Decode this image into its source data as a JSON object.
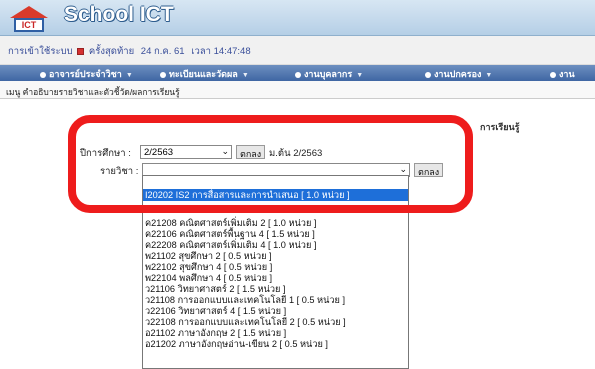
{
  "app": {
    "title": "School ICT",
    "logo_text": "ICT"
  },
  "last_login": {
    "text": "การเข้าใช้ระบบ",
    "suffix": "ครั้งสุดท้าย",
    "date": "24 ก.ค. 61",
    "time_label": "เวลา",
    "time": "14:47:48"
  },
  "menu": [
    {
      "label": "อาจารย์ประจำวิชา"
    },
    {
      "label": "ทะเบียนและวัดผล"
    },
    {
      "label": "งานบุคลากร"
    },
    {
      "label": "งานปกครอง"
    },
    {
      "label": "งาน"
    }
  ],
  "breadcrumb": "เมนู คำอธิบายรายวิชาและตัวชี้วัด/ผลการเรียนรู้",
  "section_title": "การเรียนรู้",
  "form": {
    "year_label": "ปีการศึกษา :",
    "year_value": "2/2563",
    "ok_label": "ตกลง",
    "level_note": "ม.ต้น 2/2563",
    "subject_label": "รายวิชา :",
    "subject_value": "",
    "ok2_label": "ตกลง"
  },
  "colors": {
    "highlight": "#ee1c1c",
    "menu": "#4a6fab",
    "selected": "#1e6fd9"
  },
  "options": [
    {
      "text": "I20202 IS2 การสื่อสารและการนำเสนอ  [ 1.0 หน่วย ]",
      "selected": true
    },
    {
      "text": "ค21208 คณิตศาสตร์เพิ่มเติม 2  [ 1.0 หน่วย ]"
    },
    {
      "text": "ค22106 คณิตศาสตร์พื้นฐาน 4  [ 1.5 หน่วย ]"
    },
    {
      "text": "ค22208 คณิตศาสตร์เพิ่มเติม 4  [ 1.0 หน่วย ]"
    },
    {
      "text": "พ21102 สุขศึกษา 2  [ 0.5 หน่วย ]"
    },
    {
      "text": "พ22102 สุขศึกษา 4  [ 0.5 หน่วย ]"
    },
    {
      "text": "พ22104 พลศึกษา 4  [ 0.5 หน่วย ]"
    },
    {
      "text": "ว21106 วิทยาศาสตร์ 2  [ 1.5 หน่วย ]"
    },
    {
      "text": "ว21108 การออกแบบและเทคโนโลยี 1  [ 0.5 หน่วย ]"
    },
    {
      "text": "ว22106 วิทยาศาสตร์ 4  [ 1.5 หน่วย ]"
    },
    {
      "text": "ว22108 การออกแบบและเทคโนโลยี 2  [ 0.5 หน่วย ]"
    },
    {
      "text": "อ21102 ภาษาอังกฤษ 2  [ 1.5 หน่วย ]"
    },
    {
      "text": "อ21202 ภาษาอังกฤษอ่าน-เขียน 2  [ 0.5 หน่วย ]"
    }
  ]
}
